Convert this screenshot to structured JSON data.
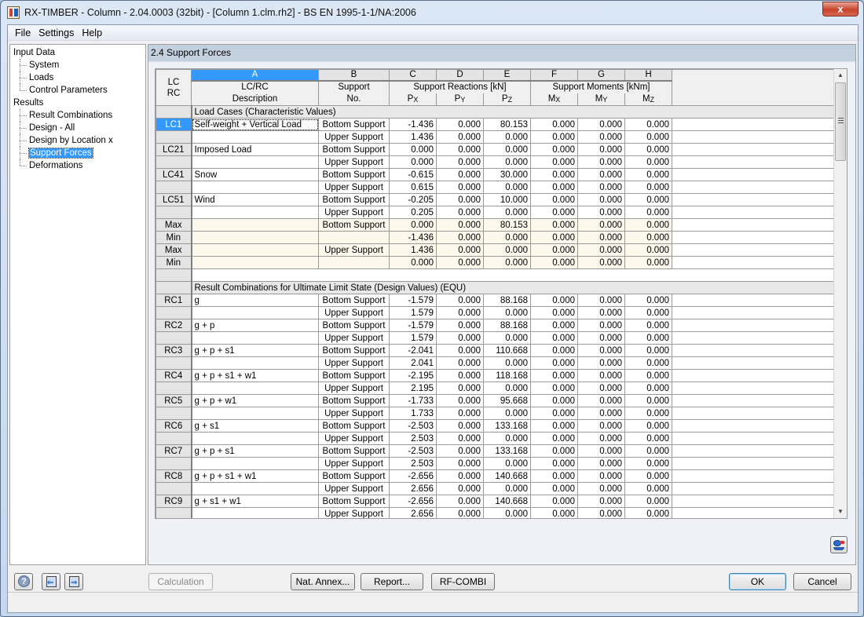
{
  "window": {
    "title": "RX-TIMBER - Column - 2.04.0003 (32bit) - [Column 1.clm.rh2] - BS EN 1995-1-1/NA:2006",
    "close_label": "x"
  },
  "menu": [
    "File",
    "Settings",
    "Help"
  ],
  "navigator": {
    "groups": [
      {
        "label": "Input Data",
        "children": [
          "System",
          "Loads",
          "Control Parameters"
        ]
      },
      {
        "label": "Results",
        "children": [
          "Result Combinations",
          "Design - All",
          "Design by Location x",
          "Support Forces",
          "Deformations"
        ]
      }
    ],
    "selected": "Support Forces"
  },
  "panel": {
    "title": "2.4 Support Forces"
  },
  "table": {
    "column_letters": [
      "A",
      "B",
      "C",
      "D",
      "E",
      "F",
      "G",
      "H"
    ],
    "header": {
      "lcrc_top": "LC",
      "lcrc_bottom": "RC",
      "a_top": "LC/RC",
      "a_bottom": "Description",
      "b_top": "Support",
      "b_bottom": "No.",
      "reactions_group": "Support Reactions [kN]",
      "moments_group": "Support Moments [kNm]",
      "sub": [
        {
          "main": "P",
          "sub": "X"
        },
        {
          "main": "P",
          "sub": "Y"
        },
        {
          "main": "P",
          "sub": "Z"
        },
        {
          "main": "M",
          "sub": "X"
        },
        {
          "main": "M",
          "sub": "Y"
        },
        {
          "main": "M",
          "sub": "Z"
        }
      ]
    },
    "rows": [
      {
        "type": "section",
        "label": "Load Cases (Characteristic Values)"
      },
      {
        "type": "data",
        "id": "LC1",
        "desc": "Self-weight + Vertical Load",
        "support": "Bottom Support",
        "values": [
          "-1.436",
          "0.000",
          "80.153",
          "0.000",
          "0.000",
          "0.000"
        ],
        "selected": true
      },
      {
        "type": "data",
        "id": "",
        "desc": "",
        "support": "Upper Support",
        "values": [
          "1.436",
          "0.000",
          "0.000",
          "0.000",
          "0.000",
          "0.000"
        ]
      },
      {
        "type": "data",
        "id": "LC21",
        "desc": "Imposed Load",
        "support": "Bottom Support",
        "values": [
          "0.000",
          "0.000",
          "0.000",
          "0.000",
          "0.000",
          "0.000"
        ]
      },
      {
        "type": "data",
        "id": "",
        "desc": "",
        "support": "Upper Support",
        "values": [
          "0.000",
          "0.000",
          "0.000",
          "0.000",
          "0.000",
          "0.000"
        ]
      },
      {
        "type": "data",
        "id": "LC41",
        "desc": "Snow",
        "support": "Bottom Support",
        "values": [
          "-0.615",
          "0.000",
          "30.000",
          "0.000",
          "0.000",
          "0.000"
        ]
      },
      {
        "type": "data",
        "id": "",
        "desc": "",
        "support": "Upper Support",
        "values": [
          "0.615",
          "0.000",
          "0.000",
          "0.000",
          "0.000",
          "0.000"
        ]
      },
      {
        "type": "data",
        "id": "LC51",
        "desc": "Wind",
        "support": "Bottom Support",
        "values": [
          "-0.205",
          "0.000",
          "10.000",
          "0.000",
          "0.000",
          "0.000"
        ]
      },
      {
        "type": "data",
        "id": "",
        "desc": "",
        "support": "Upper Support",
        "values": [
          "0.205",
          "0.000",
          "0.000",
          "0.000",
          "0.000",
          "0.000"
        ]
      },
      {
        "type": "extreme",
        "id": "Max",
        "desc": "",
        "support": "Bottom Support",
        "values": [
          "0.000",
          "0.000",
          "80.153",
          "0.000",
          "0.000",
          "0.000"
        ]
      },
      {
        "type": "extreme",
        "id": "Min",
        "desc": "",
        "support": "",
        "values": [
          "-1.436",
          "0.000",
          "0.000",
          "0.000",
          "0.000",
          "0.000"
        ]
      },
      {
        "type": "extreme",
        "id": "Max",
        "desc": "",
        "support": "Upper Support",
        "values": [
          "1.436",
          "0.000",
          "0.000",
          "0.000",
          "0.000",
          "0.000"
        ]
      },
      {
        "type": "extreme",
        "id": "Min",
        "desc": "",
        "support": "",
        "values": [
          "0.000",
          "0.000",
          "0.000",
          "0.000",
          "0.000",
          "0.000"
        ]
      },
      {
        "type": "blank"
      },
      {
        "type": "section",
        "label": "Result Combinations for Ultimate Limit State (Design Values) (EQU)"
      },
      {
        "type": "data",
        "id": "RC1",
        "desc": "g",
        "support": "Bottom Support",
        "values": [
          "-1.579",
          "0.000",
          "88.168",
          "0.000",
          "0.000",
          "0.000"
        ]
      },
      {
        "type": "data",
        "id": "",
        "desc": "",
        "support": "Upper Support",
        "values": [
          "1.579",
          "0.000",
          "0.000",
          "0.000",
          "0.000",
          "0.000"
        ]
      },
      {
        "type": "data",
        "id": "RC2",
        "desc": "g + p",
        "support": "Bottom Support",
        "values": [
          "-1.579",
          "0.000",
          "88.168",
          "0.000",
          "0.000",
          "0.000"
        ]
      },
      {
        "type": "data",
        "id": "",
        "desc": "",
        "support": "Upper Support",
        "values": [
          "1.579",
          "0.000",
          "0.000",
          "0.000",
          "0.000",
          "0.000"
        ]
      },
      {
        "type": "data",
        "id": "RC3",
        "desc": "g + p + s1",
        "support": "Bottom Support",
        "values": [
          "-2.041",
          "0.000",
          "110.668",
          "0.000",
          "0.000",
          "0.000"
        ]
      },
      {
        "type": "data",
        "id": "",
        "desc": "",
        "support": "Upper Support",
        "values": [
          "2.041",
          "0.000",
          "0.000",
          "0.000",
          "0.000",
          "0.000"
        ]
      },
      {
        "type": "data",
        "id": "RC4",
        "desc": "g + p + s1 + w1",
        "support": "Bottom Support",
        "values": [
          "-2.195",
          "0.000",
          "118.168",
          "0.000",
          "0.000",
          "0.000"
        ]
      },
      {
        "type": "data",
        "id": "",
        "desc": "",
        "support": "Upper Support",
        "values": [
          "2.195",
          "0.000",
          "0.000",
          "0.000",
          "0.000",
          "0.000"
        ]
      },
      {
        "type": "data",
        "id": "RC5",
        "desc": "g + p + w1",
        "support": "Bottom Support",
        "values": [
          "-1.733",
          "0.000",
          "95.668",
          "0.000",
          "0.000",
          "0.000"
        ]
      },
      {
        "type": "data",
        "id": "",
        "desc": "",
        "support": "Upper Support",
        "values": [
          "1.733",
          "0.000",
          "0.000",
          "0.000",
          "0.000",
          "0.000"
        ]
      },
      {
        "type": "data",
        "id": "RC6",
        "desc": "g + s1",
        "support": "Bottom Support",
        "values": [
          "-2.503",
          "0.000",
          "133.168",
          "0.000",
          "0.000",
          "0.000"
        ]
      },
      {
        "type": "data",
        "id": "",
        "desc": "",
        "support": "Upper Support",
        "values": [
          "2.503",
          "0.000",
          "0.000",
          "0.000",
          "0.000",
          "0.000"
        ]
      },
      {
        "type": "data",
        "id": "RC7",
        "desc": "g + p + s1",
        "support": "Bottom Support",
        "values": [
          "-2.503",
          "0.000",
          "133.168",
          "0.000",
          "0.000",
          "0.000"
        ]
      },
      {
        "type": "data",
        "id": "",
        "desc": "",
        "support": "Upper Support",
        "values": [
          "2.503",
          "0.000",
          "0.000",
          "0.000",
          "0.000",
          "0.000"
        ]
      },
      {
        "type": "data",
        "id": "RC8",
        "desc": "g + p + s1 + w1",
        "support": "Bottom Support",
        "values": [
          "-2.656",
          "0.000",
          "140.668",
          "0.000",
          "0.000",
          "0.000"
        ]
      },
      {
        "type": "data",
        "id": "",
        "desc": "",
        "support": "Upper Support",
        "values": [
          "2.656",
          "0.000",
          "0.000",
          "0.000",
          "0.000",
          "0.000"
        ]
      },
      {
        "type": "data",
        "id": "RC9",
        "desc": "g + s1 + w1",
        "support": "Bottom Support",
        "values": [
          "-2.656",
          "0.000",
          "140.668",
          "0.000",
          "0.000",
          "0.000"
        ]
      },
      {
        "type": "data",
        "id": "",
        "desc": "",
        "support": "Upper Support",
        "values": [
          "2.656",
          "0.000",
          "0.000",
          "0.000",
          "0.000",
          "0.000"
        ]
      }
    ]
  },
  "icons": {
    "help": "?",
    "prev": "⇐",
    "next": "⇒",
    "scroll_up": "▲",
    "scroll_down": "▼"
  },
  "buttons": {
    "calculation": "Calculation",
    "nat_annex": "Nat. Annex...",
    "report": "Report...",
    "rf_combi": "RF-COMBI",
    "ok": "OK",
    "cancel": "Cancel"
  },
  "colors": {
    "selection": "#3399ff",
    "extreme_row_bg": "#fdf8ec",
    "panel_header_bg": "#c3d0de"
  }
}
